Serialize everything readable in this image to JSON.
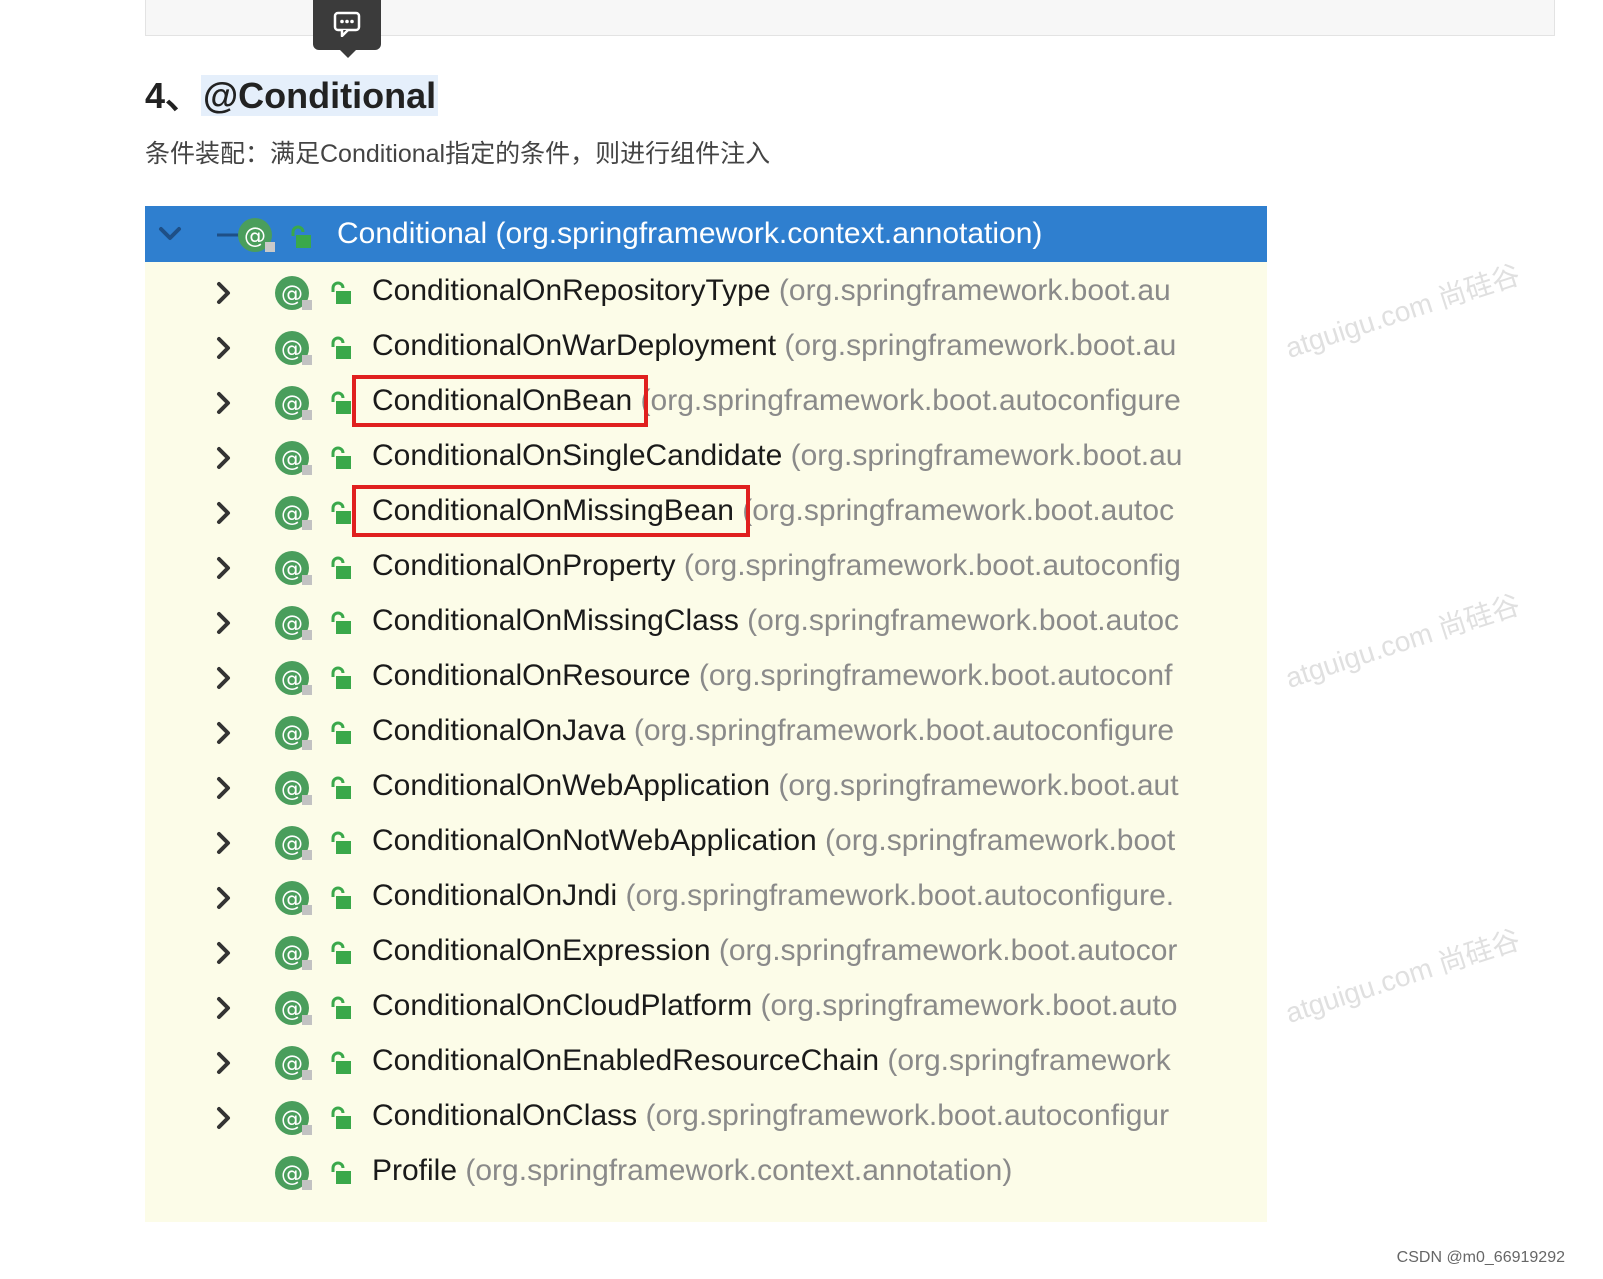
{
  "heading": {
    "number": "4、",
    "title": "@Conditional"
  },
  "subtitle": "条件装配：满足Conditional指定的条件，则进行组件注入",
  "tree": {
    "root": {
      "name": "Conditional",
      "package": "(org.springframework.context.annotation)"
    },
    "items": [
      {
        "name": "ConditionalOnRepositoryType",
        "package": "(org.springframework.boot.au",
        "expandable": true,
        "highlighted": false
      },
      {
        "name": "ConditionalOnWarDeployment",
        "package": "(org.springframework.boot.au",
        "expandable": true,
        "highlighted": false
      },
      {
        "name": "ConditionalOnBean",
        "package": "(org.springframework.boot.autoconfigure",
        "expandable": true,
        "highlighted": true
      },
      {
        "name": "ConditionalOnSingleCandidate",
        "package": "(org.springframework.boot.au",
        "expandable": true,
        "highlighted": false
      },
      {
        "name": "ConditionalOnMissingBean",
        "package": "(org.springframework.boot.autoc",
        "expandable": true,
        "highlighted": true
      },
      {
        "name": "ConditionalOnProperty",
        "package": "(org.springframework.boot.autoconfig",
        "expandable": true,
        "highlighted": false
      },
      {
        "name": "ConditionalOnMissingClass",
        "package": "(org.springframework.boot.autoc",
        "expandable": true,
        "highlighted": false
      },
      {
        "name": "ConditionalOnResource",
        "package": "(org.springframework.boot.autoconf",
        "expandable": true,
        "highlighted": false
      },
      {
        "name": "ConditionalOnJava",
        "package": "(org.springframework.boot.autoconfigure",
        "expandable": true,
        "highlighted": false
      },
      {
        "name": "ConditionalOnWebApplication",
        "package": "(org.springframework.boot.aut",
        "expandable": true,
        "highlighted": false
      },
      {
        "name": "ConditionalOnNotWebApplication",
        "package": "(org.springframework.boot",
        "expandable": true,
        "highlighted": false
      },
      {
        "name": "ConditionalOnJndi",
        "package": "(org.springframework.boot.autoconfigure.",
        "expandable": true,
        "highlighted": false
      },
      {
        "name": "ConditionalOnExpression",
        "package": "(org.springframework.boot.autocor",
        "expandable": true,
        "highlighted": false
      },
      {
        "name": "ConditionalOnCloudPlatform",
        "package": "(org.springframework.boot.auto",
        "expandable": true,
        "highlighted": false
      },
      {
        "name": "ConditionalOnEnabledResourceChain",
        "package": "(org.springframework",
        "expandable": true,
        "highlighted": false
      },
      {
        "name": "ConditionalOnClass",
        "package": "(org.springframework.boot.autoconfigur",
        "expandable": true,
        "highlighted": false
      },
      {
        "name": "Profile",
        "package": "(org.springframework.context.annotation)",
        "expandable": false,
        "highlighted": false
      }
    ]
  },
  "watermarks": {
    "diagonal": "atguigu.com 尚硅谷",
    "small": "atguigu.com 尚硅谷"
  },
  "footer": {
    "credit": "CSDN @m0_66919292"
  },
  "colors": {
    "header_bg": "#2f7fcf",
    "tree_bg": "#fcfce8",
    "annotation_icon": "#4a9e5c",
    "highlight_box": "#e0201f"
  },
  "icons": {
    "comment": "comment-icon",
    "expand": "chevron-right-icon",
    "collapse": "chevron-down-icon",
    "annotation": "annotation-at-icon",
    "access": "lock-icon"
  }
}
